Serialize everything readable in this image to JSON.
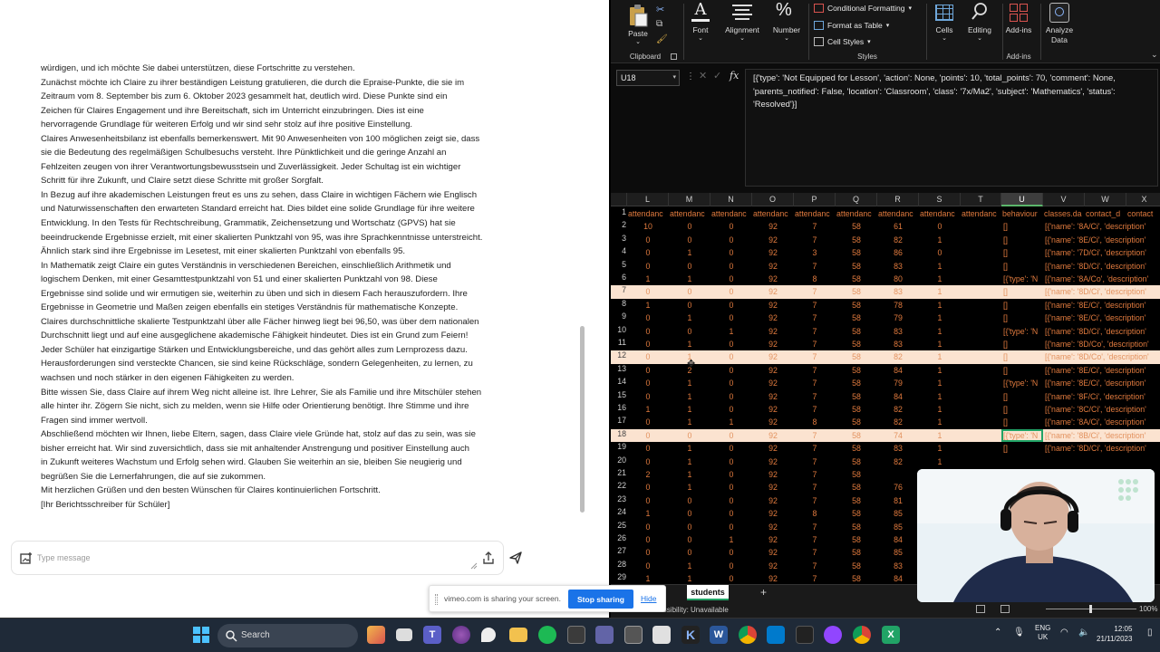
{
  "chat": {
    "paragraphs": [
      "würdigen, und ich möchte Sie dabei unterstützen, diese Fortschritte zu verstehen.",
      "Zunächst möchte ich Claire zu ihrer beständigen Leistung gratulieren, die durch die Epraise-Punkte, die sie im",
      "Zeitraum vom 8. September bis zum 6. Oktober 2023 gesammelt hat, deutlich wird. Diese Punkte sind ein",
      "Zeichen für Claires Engagement und ihre Bereitschaft, sich im Unterricht einzubringen. Dies ist eine",
      "hervorragende Grundlage für weiteren Erfolg und wir sind sehr stolz auf ihre positive Einstellung.",
      "Claires Anwesenheitsbilanz ist ebenfalls bemerkenswert. Mit 90 Anwesenheiten von 100 möglichen zeigt sie, dass",
      "sie die Bedeutung des regelmäßigen Schulbesuchs versteht. Ihre Pünktlichkeit und die geringe Anzahl an",
      "Fehlzeiten zeugen von ihrer Verantwortungsbewusstsein und Zuverlässigkeit. Jeder Schultag ist ein wichtiger",
      "Schritt für ihre Zukunft, und Claire setzt diese Schritte mit großer Sorgfalt.",
      "In Bezug auf ihre akademischen Leistungen freut es uns zu sehen, dass Claire in wichtigen Fächern wie Englisch",
      "und Naturwissenschaften den erwarteten Standard erreicht hat. Dies bildet eine solide Grundlage für ihre weitere",
      "Entwicklung. In den Tests für Rechtschreibung, Grammatik, Zeichensetzung und Wortschatz (GPVS) hat sie",
      "beeindruckende Ergebnisse erzielt, mit einer skalierten Punktzahl von 95, was ihre Sprachkenntnisse unterstreicht.",
      "Ähnlich stark sind ihre Ergebnisse im Lesetest, mit einer skalierten Punktzahl von ebenfalls 95.",
      "In Mathematik zeigt Claire ein gutes Verständnis in verschiedenen Bereichen, einschließlich Arithmetik und",
      "logischem Denken, mit einer Gesamttestpunktzahl von 51 und einer skalierten Punktzahl von 98. Diese",
      "Ergebnisse sind solide und wir ermutigen sie, weiterhin zu üben und sich in diesem Fach herauszufordern. Ihre",
      "Ergebnisse in Geometrie und Maßen zeigen ebenfalls ein stetiges Verständnis für mathematische Konzepte.",
      "Claires durchschnittliche skalierte Testpunktzahl über alle Fächer hinweg liegt bei 96,50, was über dem nationalen",
      "Durchschnitt liegt und auf eine ausgeglichene akademische Fähigkeit hindeutet. Dies ist ein Grund zum Feiern!",
      "Jeder Schüler hat einzigartige Stärken und Entwicklungsbereiche, und das gehört alles zum Lernprozess dazu.",
      "Herausforderungen sind versteckte Chancen, sie sind keine Rückschläge, sondern Gelegenheiten, zu lernen, zu",
      "wachsen und noch stärker in den eigenen Fähigkeiten zu werden.",
      "Bitte wissen Sie, dass Claire auf ihrem Weg nicht alleine ist. Ihre Lehrer, Sie als Familie und ihre Mitschüler stehen",
      "alle hinter ihr. Zögern Sie nicht, sich zu melden, wenn sie Hilfe oder Orientierung benötigt. Ihre Stimme und ihre",
      "Fragen sind immer wertvoll.",
      "Abschließend möchten wir Ihnen, liebe Eltern, sagen, dass Claire viele Gründe hat, stolz auf das zu sein, was sie",
      "bisher erreicht hat. Wir sind zuversichtlich, dass sie mit anhaltender Anstrengung und positiver Einstellung auch",
      "in Zukunft weiteres Wachstum und Erfolg sehen wird. Glauben Sie weiterhin an sie, bleiben Sie neugierig und",
      "begrüßen Sie die Lernerfahrungen, die auf sie zukommen.",
      "Mit herzlichen Grüßen und den besten Wünschen für Claires kontinuierlichen Fortschritt.",
      "[Ihr Berichtsschreiber für Schüler]"
    ],
    "input_placeholder": "Type message"
  },
  "share_bar": {
    "text": "vimeo.com is sharing your screen.",
    "stop_label": "Stop sharing",
    "hide_label": "Hide"
  },
  "ribbon": {
    "paste": "Paste",
    "clipboard": "Clipboard",
    "font": "Font",
    "alignment": "Alignment",
    "number": "Number",
    "conditional_formatting": "Conditional Formatting",
    "format_as_table": "Format as Table",
    "cell_styles": "Cell Styles",
    "styles": "Styles",
    "cells": "Cells",
    "editing": "Editing",
    "add_ins": "Add-ins",
    "add_ins_group": "Add-ins",
    "analyze_data_1": "Analyze",
    "analyze_data_2": "Data"
  },
  "formula_bar": {
    "name_box": "U18",
    "fx": "fx",
    "content": "[{'type': 'Not Equipped for Lesson', 'action': None, 'points': 10, 'total_points': 70, 'comment': None, 'parents_notified': False, 'location': 'Classroom', 'class': '7x/Ma2', 'subject': 'Mathematics', 'status': 'Resolved'}]"
  },
  "grid": {
    "columns": [
      "L",
      "M",
      "N",
      "O",
      "P",
      "Q",
      "R",
      "S",
      "T",
      "U",
      "V",
      "W",
      "X"
    ],
    "selected_column": "U",
    "selected_cell": "U18",
    "header_row": [
      "attendanc",
      "attendanc",
      "attendanc",
      "attendanc",
      "attendanc",
      "attendanc",
      "attendanc",
      "attendanc",
      "attendanc",
      "behaviour",
      "classes.da",
      "contact_d",
      "contact"
    ],
    "highlighted_rows": [
      7,
      12,
      18
    ],
    "rows": [
      {
        "n": "2",
        "c": [
          "10",
          "0",
          "0",
          "92",
          "7",
          "58",
          "61",
          "0",
          "",
          "[]",
          "[{'name': '8A/Ci', 'description'"
        ]
      },
      {
        "n": "3",
        "c": [
          "0",
          "0",
          "0",
          "92",
          "7",
          "58",
          "82",
          "1",
          "",
          "[]",
          "[{'name': '8E/Ci', 'description'"
        ]
      },
      {
        "n": "4",
        "c": [
          "0",
          "1",
          "0",
          "92",
          "3",
          "58",
          "86",
          "0",
          "",
          "[]",
          "[{'name': '7D/Ci', 'description'"
        ]
      },
      {
        "n": "5",
        "c": [
          "0",
          "0",
          "0",
          "92",
          "7",
          "58",
          "83",
          "1",
          "",
          "[]",
          "[{'name': '8D/Ci', 'description'"
        ]
      },
      {
        "n": "6",
        "c": [
          "1",
          "1",
          "0",
          "92",
          "8",
          "58",
          "80",
          "1",
          "",
          "[{'type': 'N",
          "[{'name': '8A/Co', 'description'"
        ]
      },
      {
        "n": "7",
        "c": [
          "0",
          "0",
          "0",
          "92",
          "7",
          "58",
          "83",
          "1",
          "",
          "[]",
          "[{'name': '8D/Ci', 'description'"
        ]
      },
      {
        "n": "8",
        "c": [
          "1",
          "0",
          "0",
          "92",
          "7",
          "58",
          "78",
          "1",
          "",
          "[]",
          "[{'name': '8E/Ci', 'description'"
        ]
      },
      {
        "n": "9",
        "c": [
          "0",
          "1",
          "0",
          "92",
          "7",
          "58",
          "79",
          "1",
          "",
          "[]",
          "[{'name': '8E/Ci', 'description'"
        ]
      },
      {
        "n": "10",
        "c": [
          "0",
          "0",
          "1",
          "92",
          "7",
          "58",
          "83",
          "1",
          "",
          "[{'type': 'N",
          "[{'name': '8D/Ci', 'description'"
        ]
      },
      {
        "n": "11",
        "c": [
          "0",
          "1",
          "0",
          "92",
          "7",
          "58",
          "83",
          "1",
          "",
          "[]",
          "[{'name': '8D/Co', 'description'"
        ]
      },
      {
        "n": "12",
        "c": [
          "0",
          "1",
          "0",
          "92",
          "7",
          "58",
          "82",
          "1",
          "",
          "[]",
          "[{'name': '8D/Co', 'description'"
        ]
      },
      {
        "n": "13",
        "c": [
          "0",
          "2",
          "0",
          "92",
          "7",
          "58",
          "84",
          "1",
          "",
          "[]",
          "[{'name': '8E/Ci', 'description'"
        ]
      },
      {
        "n": "14",
        "c": [
          "0",
          "1",
          "0",
          "92",
          "7",
          "58",
          "79",
          "1",
          "",
          "[{'type': 'N",
          "[{'name': '8E/Ci', 'description'"
        ]
      },
      {
        "n": "15",
        "c": [
          "0",
          "1",
          "0",
          "92",
          "7",
          "58",
          "84",
          "1",
          "",
          "[]",
          "[{'name': '8F/Ci', 'description'"
        ]
      },
      {
        "n": "16",
        "c": [
          "1",
          "1",
          "0",
          "92",
          "7",
          "58",
          "82",
          "1",
          "",
          "[]",
          "[{'name': '8C/Ci', 'description'"
        ]
      },
      {
        "n": "17",
        "c": [
          "0",
          "1",
          "1",
          "92",
          "8",
          "58",
          "82",
          "1",
          "",
          "[]",
          "[{'name': '8A/Ci', 'description'"
        ]
      },
      {
        "n": "18",
        "c": [
          "0",
          "0",
          "0",
          "92",
          "7",
          "58",
          "74",
          "1",
          "",
          "[{'type': 'N",
          "[{'name': '8B/Ci', 'description'"
        ]
      },
      {
        "n": "19",
        "c": [
          "0",
          "1",
          "0",
          "92",
          "7",
          "58",
          "83",
          "1",
          "",
          "[]",
          "[{'name': '8D/Ci', 'description'"
        ]
      },
      {
        "n": "20",
        "c": [
          "0",
          "1",
          "0",
          "92",
          "7",
          "58",
          "82",
          "1",
          "",
          "",
          ""
        ]
      },
      {
        "n": "21",
        "c": [
          "2",
          "1",
          "0",
          "92",
          "7",
          "58",
          "",
          "",
          "",
          "",
          ""
        ]
      },
      {
        "n": "22",
        "c": [
          "0",
          "1",
          "0",
          "92",
          "7",
          "58",
          "76",
          "",
          "",
          "",
          ""
        ]
      },
      {
        "n": "23",
        "c": [
          "0",
          "0",
          "0",
          "92",
          "7",
          "58",
          "81",
          "",
          "",
          "",
          ""
        ]
      },
      {
        "n": "24",
        "c": [
          "1",
          "0",
          "0",
          "92",
          "8",
          "58",
          "85",
          "",
          "",
          "",
          ""
        ]
      },
      {
        "n": "25",
        "c": [
          "0",
          "0",
          "0",
          "92",
          "7",
          "58",
          "85",
          "",
          "",
          "",
          ""
        ]
      },
      {
        "n": "26",
        "c": [
          "0",
          "0",
          "1",
          "92",
          "7",
          "58",
          "84",
          "",
          "",
          "",
          ""
        ]
      },
      {
        "n": "27",
        "c": [
          "0",
          "0",
          "0",
          "92",
          "7",
          "58",
          "85",
          "",
          "",
          "",
          ""
        ]
      },
      {
        "n": "28",
        "c": [
          "0",
          "1",
          "0",
          "92",
          "7",
          "58",
          "83",
          "",
          "",
          "",
          ""
        ]
      },
      {
        "n": "29",
        "c": [
          "1",
          "1",
          "0",
          "92",
          "7",
          "58",
          "84",
          "",
          "",
          "",
          ""
        ]
      }
    ]
  },
  "status_bar": {
    "sheet_tab": "students",
    "add_sheet": "+",
    "accessibility": "Accessibility: Unavailable",
    "zoom": "100%"
  },
  "taskbar": {
    "search_label": "Search",
    "lang_1": "ENG",
    "lang_2": "UK",
    "time": "12:05",
    "date": "21/11/2023"
  },
  "colors": {
    "excel_accent": "#21a366",
    "cell_text": "#e07a3e",
    "row_highlight": "#fbe3d0",
    "share_stop": "#1a73e8",
    "taskbar": "#1f2a38"
  }
}
